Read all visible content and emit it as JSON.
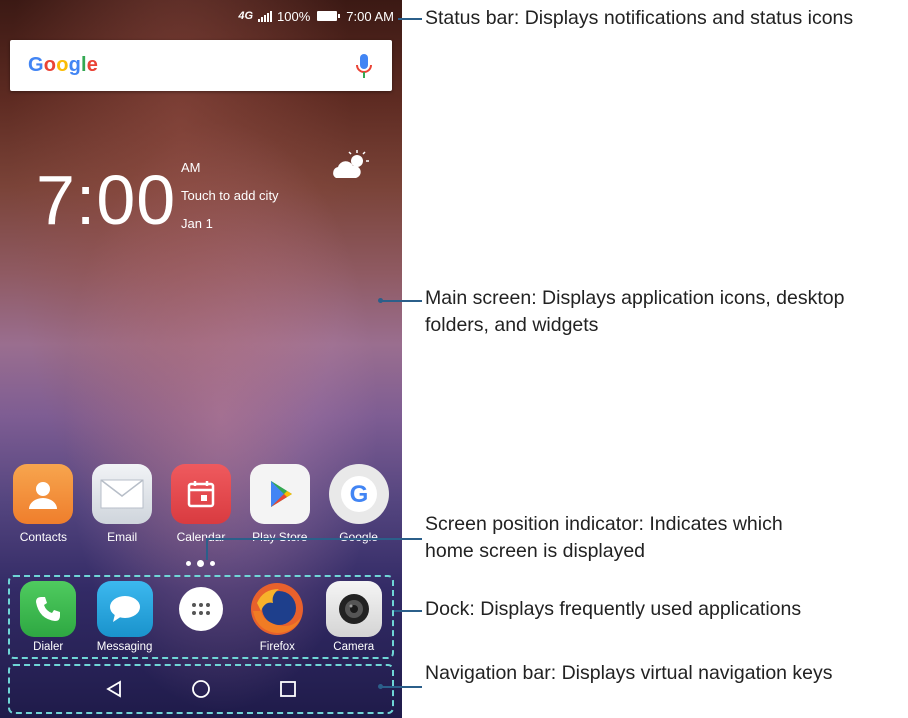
{
  "status_bar": {
    "network": "4G",
    "battery": "100%",
    "time": "7:00 AM"
  },
  "search": {
    "logo": "Google",
    "mic_icon": "microphone-icon"
  },
  "clock_widget": {
    "time": "7:00",
    "ampm": "AM",
    "city": "Touch to add city",
    "date": "Jan 1",
    "weather_icon": "partly-cloudy-icon"
  },
  "apps": [
    {
      "label": "Contacts",
      "icon": "contacts-icon",
      "color": "#f5923e"
    },
    {
      "label": "Email",
      "icon": "email-icon",
      "color": "#dfe4ea"
    },
    {
      "label": "Calendar",
      "icon": "calendar-icon",
      "color": "#e8474c"
    },
    {
      "label": "Play Store",
      "icon": "play-store-icon",
      "color": "#f4f4f4"
    },
    {
      "label": "Google",
      "icon": "google-icon",
      "color": "#eeeeee"
    }
  ],
  "dock": [
    {
      "label": "Dialer",
      "icon": "phone-icon",
      "color": "#3dbb4f"
    },
    {
      "label": "Messaging",
      "icon": "messaging-icon",
      "color": "#29a8e0"
    },
    {
      "label": "",
      "icon": "app-drawer-icon",
      "color": "#ffffff"
    },
    {
      "label": "Firefox",
      "icon": "firefox-icon",
      "color": "#e8612c"
    },
    {
      "label": "Camera",
      "icon": "camera-icon",
      "color": "#e5e5e5"
    }
  ],
  "navbar": {
    "back_icon": "back-triangle-icon",
    "home_icon": "home-circle-icon",
    "recent_icon": "recent-square-icon"
  },
  "annotations": {
    "status_bar": "Status bar: Displays notifications and status icons",
    "main_screen": "Main screen: Displays application icons, desktop folders, and widgets",
    "indicator": "Screen position indicator: Indicates which home screen is displayed",
    "dock": "Dock: Displays frequently used applications",
    "navbar": "Navigation bar: Displays virtual navigation keys"
  },
  "colors": {
    "callout_line": "#2b5f8a",
    "dashed_border": "#6fd6d6"
  }
}
